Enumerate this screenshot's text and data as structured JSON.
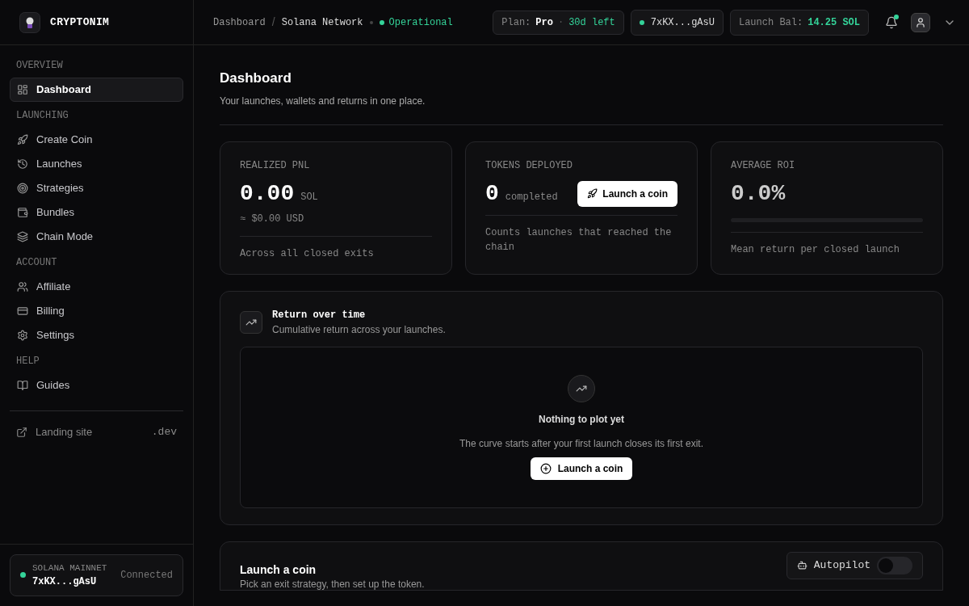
{
  "brand": {
    "name": "CRYPTONIM"
  },
  "header": {
    "breadcrumb": [
      "Dashboard",
      "Solana Network"
    ],
    "breadcrumb_separator": "/",
    "status": "Operational",
    "plan": {
      "label": "Plan:",
      "tier": "Pro",
      "separator": "·",
      "remaining": "30d left"
    },
    "wallet": "7xKX...gAsU",
    "balance": {
      "label": "Launch Bal:",
      "value": "14.25 SOL"
    },
    "notifications_unread": true
  },
  "sidebar": {
    "sections": [
      {
        "title": "OVERVIEW",
        "items": [
          {
            "label": "Dashboard",
            "selected": true
          }
        ]
      },
      {
        "title": "LAUNCHING",
        "items": [
          {
            "label": "Create Coin",
            "selected": false
          },
          {
            "label": "Launches",
            "selected": false
          },
          {
            "label": "Strategies",
            "selected": false
          },
          {
            "label": "Bundles",
            "selected": false
          },
          {
            "label": "Chain Mode",
            "selected": false
          }
        ]
      },
      {
        "title": "ACCOUNT",
        "items": [
          {
            "label": "Affiliate",
            "selected": false
          },
          {
            "label": "Billing",
            "selected": false
          },
          {
            "label": "Settings",
            "selected": false
          }
        ]
      },
      {
        "title": "HELP",
        "items": [
          {
            "label": "Guides",
            "selected": false
          }
        ]
      }
    ],
    "link": {
      "label": "Landing site",
      "suffix": ".dev"
    },
    "network": {
      "name": "SOLANA MAINNET",
      "wallet": "7xKX...gAsU",
      "status": "Connected"
    }
  },
  "page": {
    "title": "Dashboard",
    "subtitle": "Your launches, wallets and returns in one place."
  },
  "stats": [
    {
      "kind": "value",
      "label": "REALIZED PNL",
      "value": "0.00",
      "unit": "SOL",
      "sub": "≈ $0.00 USD",
      "note": "Across all closed exits"
    },
    {
      "kind": "action",
      "label": "TOKENS DEPLOYED",
      "value": "0",
      "unit": "completed",
      "button": "Launch a coin",
      "note": "Counts launches that reached the chain"
    },
    {
      "kind": "meter",
      "label": "AVERAGE ROI",
      "value": "0.0%",
      "level": 0,
      "note": "Mean return per closed launch"
    }
  ],
  "chart_panel": {
    "title": "Return over time",
    "subtitle": "Cumulative return across your launches.",
    "empty_title": "Nothing to plot yet",
    "empty_text": "The curve starts after your first launch closes its first exit.",
    "button": "Launch a coin"
  },
  "launch_panel": {
    "title": "Launch a coin",
    "subtitle": "Pick an exit strategy, then set up the token.",
    "autopilot": {
      "label": "Autopilot",
      "on": false
    }
  }
}
